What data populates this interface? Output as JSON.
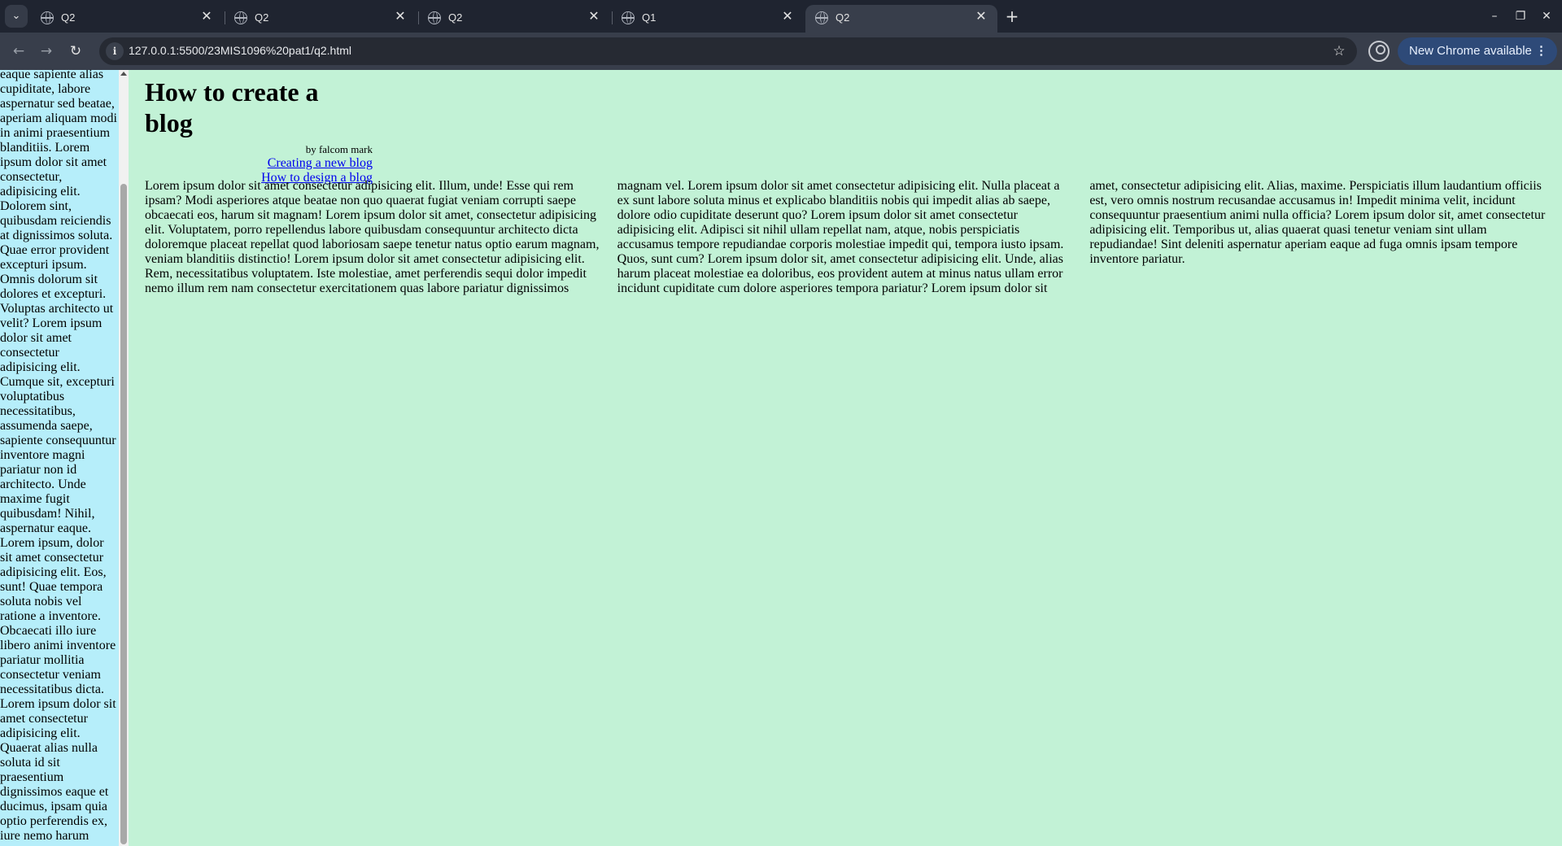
{
  "browser": {
    "tabs": [
      {
        "title": "Q2",
        "active": false
      },
      {
        "title": "Q2",
        "active": false
      },
      {
        "title": "Q2",
        "active": false
      },
      {
        "title": "Q1",
        "active": false
      },
      {
        "title": "Q2",
        "active": true
      }
    ],
    "url": "127.0.0.1:5500/23MIS1096%20pat1/q2.html",
    "update_label": "New Chrome available"
  },
  "sidebar": {
    "text": "eaque sapiente alias cupiditate, labore aspernatur sed beatae, aperiam aliquam modi in animi praesentium blanditiis. Lorem ipsum dolor sit amet consectetur, adipisicing elit. Dolorem sint, quibusdam reiciendis at dignissimos soluta. Quae error provident excepturi ipsum. Omnis dolorum sit dolores et excepturi. Voluptas architecto ut velit? Lorem ipsum dolor sit amet consectetur adipisicing elit. Cumque sit, excepturi voluptatibus necessitatibus, assumenda saepe, sapiente consequuntur inventore magni pariatur non id architecto. Unde maxime fugit quibusdam! Nihil, aspernatur eaque. Lorem ipsum, dolor sit amet consectetur adipisicing elit. Eos, sunt! Quae tempora soluta nobis vel ratione a inventore. Obcaecati illo iure libero animi inventore pariatur mollitia consectetur veniam necessitatibus dicta. Lorem ipsum dolor sit amet consectetur adipisicing elit. Quaerat alias nulla soluta id sit praesentium dignissimos eaque et ducimus, ipsam quia optio perferendis ex, iure nemo harum"
  },
  "header": {
    "title": "How to create a blog",
    "byline": "by falcom mark",
    "links": [
      "Creating a new blog",
      "How to design a blog"
    ]
  },
  "article": {
    "text": "Lorem ipsum dolor sit amet consectetur adipisicing elit. Illum, unde! Esse qui rem ipsam? Modi asperiores atque beatae non quo quaerat fugiat veniam corrupti saepe obcaecati eos, harum sit magnam! Lorem ipsum dolor sit amet, consectetur adipisicing elit. Voluptatem, porro repellendus labore quibusdam consequuntur architecto dicta doloremque placeat repellat quod laboriosam saepe tenetur natus optio earum magnam, veniam blanditiis distinctio! Lorem ipsum dolor sit amet consectetur adipisicing elit. Rem, necessitatibus voluptatem. Iste molestiae, amet perferendis sequi dolor impedit nemo illum rem nam consectetur exercitationem quas labore pariatur dignissimos magnam vel. Lorem ipsum dolor sit amet consectetur adipisicing elit. Nulla placeat a ex sunt labore soluta minus et explicabo blanditiis nobis qui impedit alias ab saepe, dolore odio cupiditate deserunt quo? Lorem ipsum dolor sit amet consectetur adipisicing elit. Adipisci sit nihil ullam repellat nam, atque, nobis perspiciatis accusamus tempore repudiandae corporis molestiae impedit qui, tempora iusto ipsam. Quos, sunt cum? Lorem ipsum dolor sit, amet consectetur adipisicing elit. Unde, alias harum placeat molestiae ea doloribus, eos provident autem at minus natus ullam error incidunt cupiditate cum dolore asperiores tempora pariatur? Lorem ipsum dolor sit amet, consectetur adipisicing elit. Alias, maxime. Perspiciatis illum laudantium officiis est, vero omnis nostrum recusandae accusamus in! Impedit minima velit, incidunt consequuntur praesentium animi nulla officia? Lorem ipsum dolor sit, amet consectetur adipisicing elit. Temporibus ut, alias quaerat quasi tenetur veniam sint ullam repudiandae! Sint deleniti aspernatur aperiam eaque ad fuga omnis ipsam tempore inventore pariatur."
  },
  "colors": {
    "page_background": "#c2f2d6",
    "sidebar_background": "#b6eefa",
    "link": "#0000ee",
    "chrome_tabbar": "#1f2430",
    "chrome_toolbar": "#383e4b",
    "update_button": "#2e4a78"
  },
  "icons": {
    "tab_search": "chevron-down-icon",
    "tab_favicon": "globe-icon",
    "tab_close": "close-icon",
    "new_tab": "plus-icon",
    "back": "arrow-left-icon",
    "forward": "arrow-right-icon",
    "reload": "reload-icon",
    "site_info": "info-icon",
    "bookmark": "star-icon",
    "profile": "profile-icon",
    "menu": "kebab-menu-icon"
  }
}
